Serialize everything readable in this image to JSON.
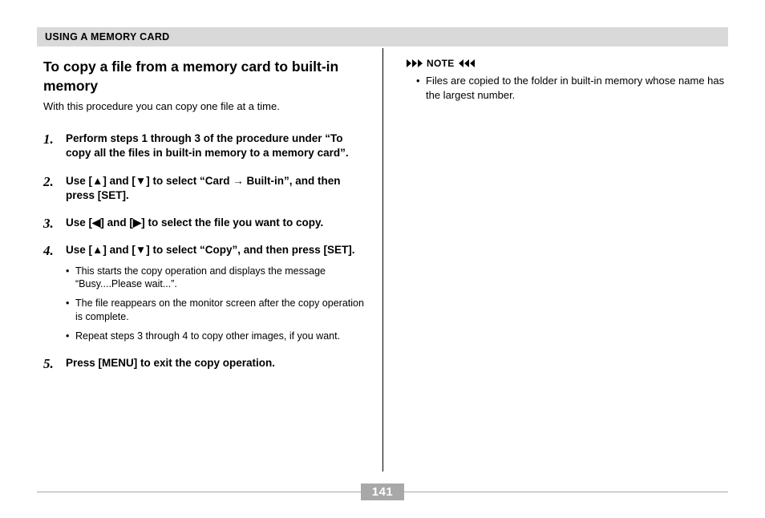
{
  "header": "USING A MEMORY CARD",
  "left": {
    "title": "To copy a file from a memory card to built-in memory",
    "intro": "With this procedure you can copy one file at a time.",
    "steps": [
      {
        "main": "Perform steps 1 through 3 of the procedure under “To copy all the files in built-in memory to a memory card”."
      },
      {
        "main": "Use [▲] and [▼] to select “Card → Built-in”, and then press [SET]."
      },
      {
        "main": "Use [◀] and [▶] to select the file you want to copy."
      },
      {
        "main": "Use [▲] and [▼] to select “Copy”, and then press [SET].",
        "sub": [
          "This starts the copy operation and displays the message “Busy....Please wait...”.",
          "The file reappears on the monitor screen after the copy operation is complete.",
          "Repeat steps 3 through 4 to copy other images, if you want."
        ]
      },
      {
        "main": "Press [MENU] to exit the copy operation."
      }
    ]
  },
  "right": {
    "note_label": "NOTE",
    "notes": [
      "Files are copied to the folder in built-in memory whose name has the largest number."
    ]
  },
  "page_number": "141"
}
